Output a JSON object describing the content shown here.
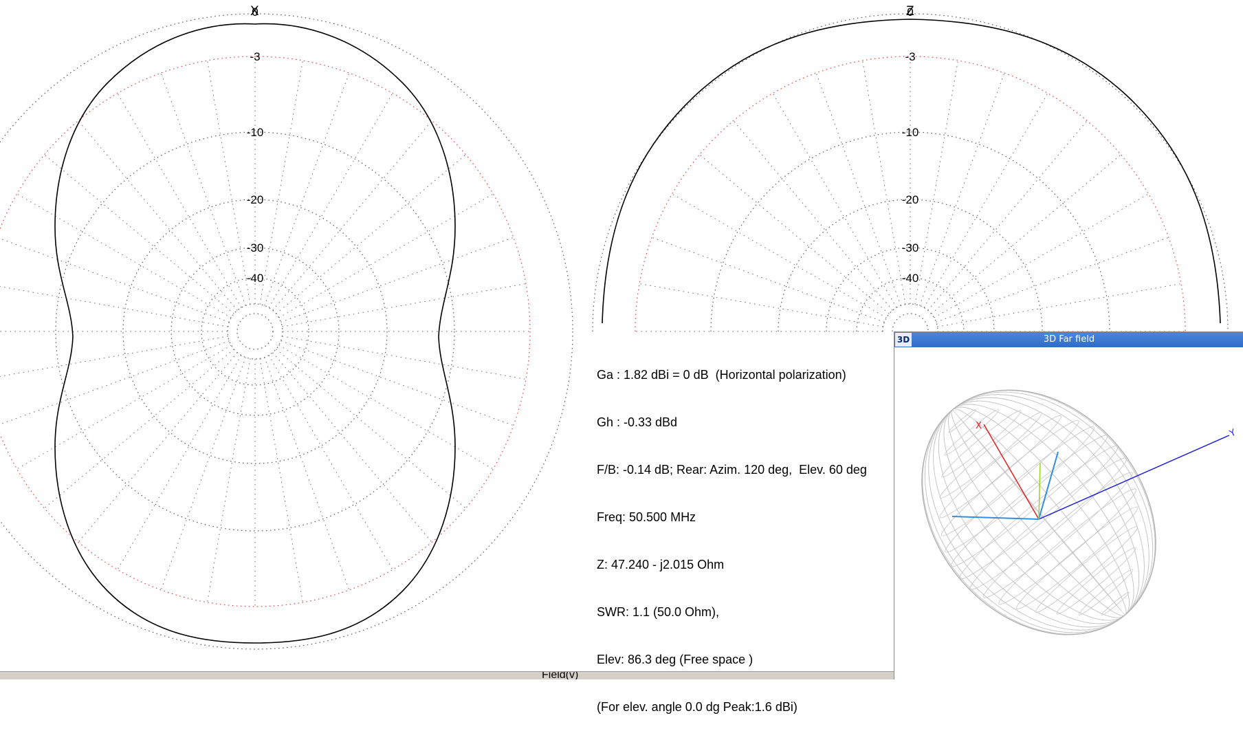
{
  "azimuth_plot": {
    "axis_label": "X",
    "ring_labels": [
      "0",
      "-3",
      "-10",
      "-20",
      "-30",
      "-40"
    ]
  },
  "elevation_plot": {
    "axis_label": "Z",
    "ring_labels": [
      "0",
      "-3",
      "-10",
      "-20",
      "-30",
      "-40"
    ]
  },
  "info": {
    "lines": [
      "Ga : 1.82 dBi = 0 dB  (Horizontal polarization)",
      "Gh : -0.33 dBd",
      "F/B: -0.14 dB; Rear: Azim. 120 deg,  Elev. 60 deg",
      "Freq: 50.500 MHz",
      "Z: 47.240 - j2.015 Ohm",
      "SWR: 1.1 (50.0 Ohm),",
      "Elev: 86.3 deg (Free space )",
      "(For elev. angle 0.0 dg Peak:1.6 dBi)"
    ]
  },
  "status_bar": {
    "text": "Field(v)"
  },
  "window_3d": {
    "badge": "3D",
    "title": "3D Far field",
    "axis_labels": {
      "x": "X",
      "y": "Y"
    },
    "colors": {
      "x_axis": "#e02020",
      "y_axis": "#2020e0",
      "z_axis": "#2f8fe0",
      "mesh": "#c4c4c4"
    }
  },
  "colors": {
    "pattern": "#000000",
    "ring_red": "#e04040",
    "grid": "#666666"
  }
}
